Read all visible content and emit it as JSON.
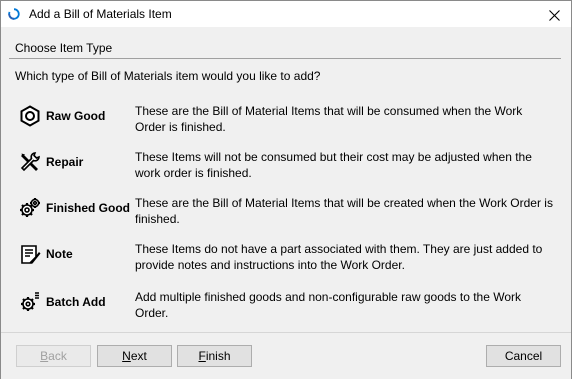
{
  "window": {
    "title": "Add a Bill of Materials Item"
  },
  "section": {
    "title": "Choose Item Type",
    "question": "Which type of Bill of Materials item would you like to add?"
  },
  "options": [
    {
      "label": "Raw Good",
      "icon": "nut-icon",
      "description": "These are the Bill of Material Items that will be consumed when the Work Order is finished."
    },
    {
      "label": "Repair",
      "icon": "wrench-screwdriver-icon",
      "description": "These Items will not be consumed but their cost may be adjusted when the work order is finished."
    },
    {
      "label": "Finished Good",
      "icon": "gears-icon",
      "description": "These are the Bill of Material Items that will be created when the Work Order is finished."
    },
    {
      "label": "Note",
      "icon": "note-pen-icon",
      "description": "These Items do not have a part associated with them. They are just added to provide notes and instructions into the Work Order."
    },
    {
      "label": "Batch Add",
      "icon": "gear-batch-icon",
      "description": "Add multiple finished goods and non-configurable raw goods to the Work Order."
    }
  ],
  "buttons": {
    "back": {
      "first": "B",
      "rest": "ack",
      "enabled": false
    },
    "next": {
      "first": "N",
      "rest": "ext",
      "enabled": true
    },
    "finish": {
      "first": "F",
      "rest": "inish",
      "enabled": true
    },
    "cancel": {
      "label": "Cancel",
      "enabled": true
    }
  },
  "colors": {
    "background": "#f0f0f0",
    "accent": "#0078d7"
  }
}
